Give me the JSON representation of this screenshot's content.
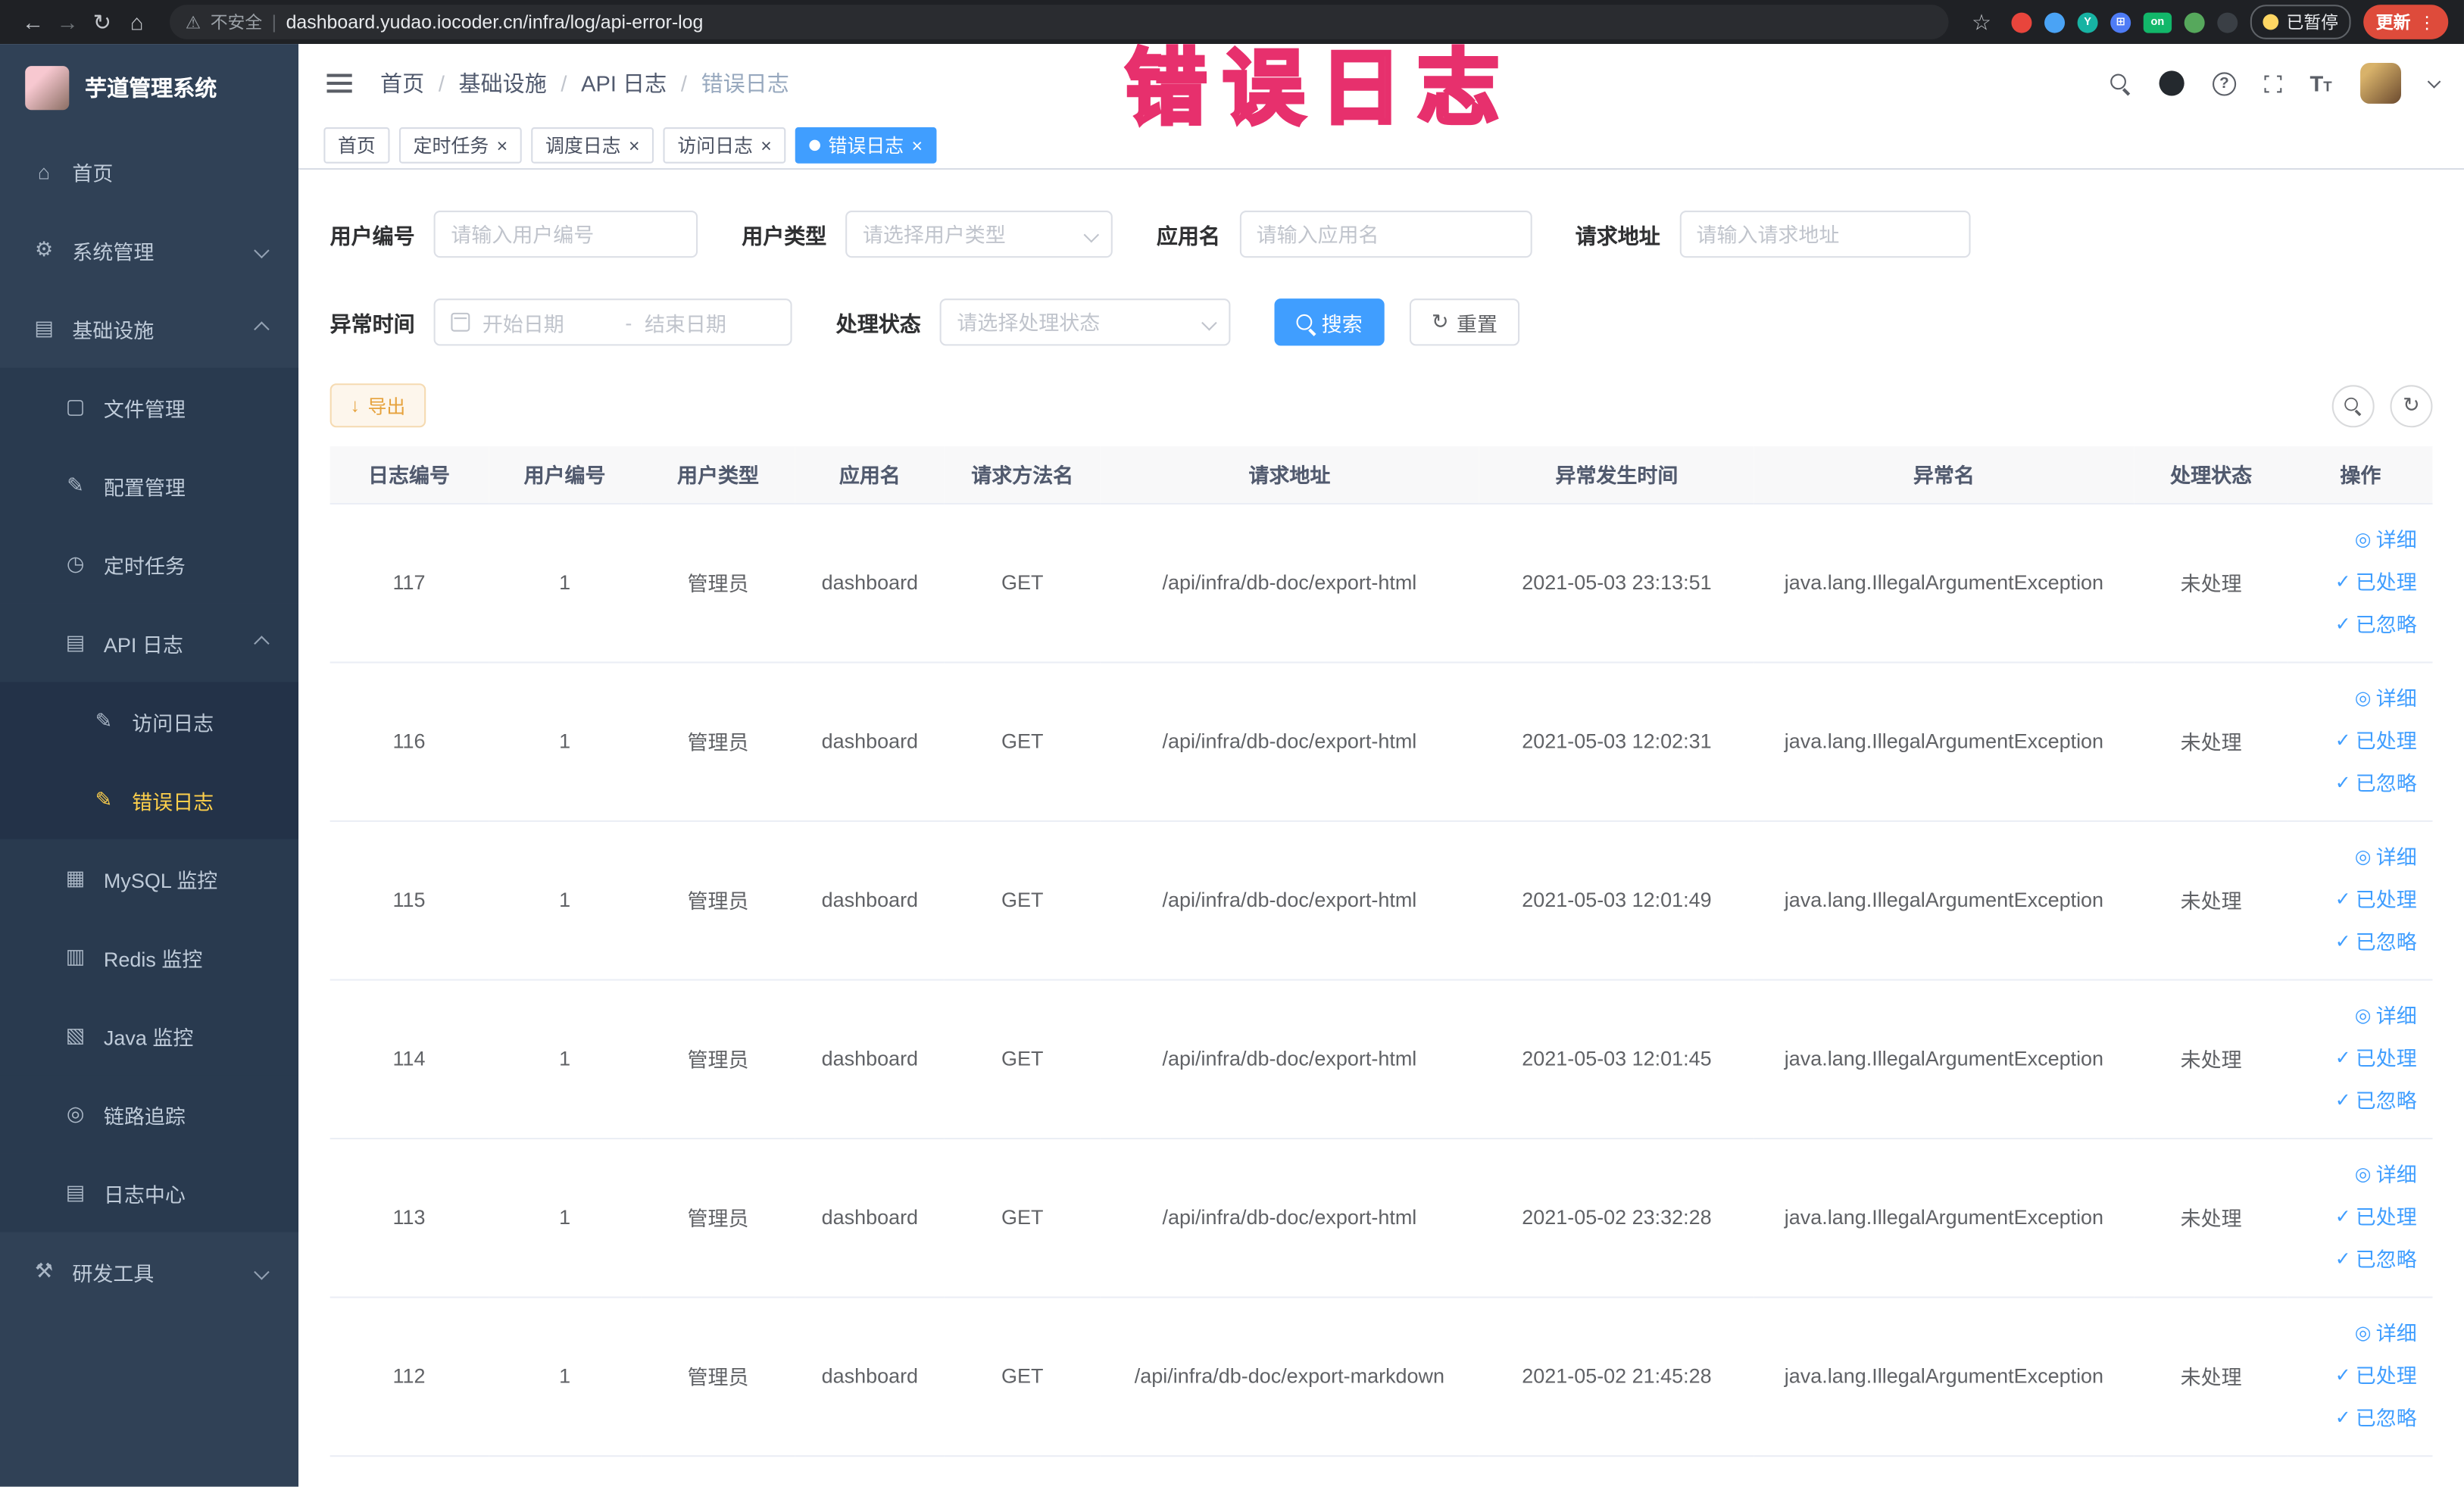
{
  "colors": {
    "accent": "#409eff",
    "sidebar_bg": "#304156",
    "sidebar_active_text": "#ffd04b",
    "warning": "#e6a23c",
    "update_button_red": "#de4b3b",
    "watermark_pink": "#e7306d",
    "link": "#409eff"
  },
  "watermark": "错误日志",
  "browser": {
    "security_label": "不安全",
    "url": "dashboard.yudao.iocoder.cn/infra/log/api-error-log",
    "paused_badge": "已暂停",
    "update_button": "更新",
    "nav_icons": [
      "back-arrow-icon",
      "forward-arrow-icon",
      "reload-icon",
      "home-icon"
    ],
    "extension_icons": [
      {
        "name": "extension-red-circle-icon",
        "color": "#e8453c",
        "glyph": "",
        "shape": "circle"
      },
      {
        "name": "extension-blue-drop-icon",
        "color": "#4aa3f5",
        "glyph": "",
        "shape": "circle"
      },
      {
        "name": "extension-teal-y-icon",
        "color": "#17b3a3",
        "glyph": "Y",
        "shape": "circle"
      },
      {
        "name": "extension-blue-grid-icon",
        "color": "#4e7cf6",
        "glyph": "⊞",
        "shape": "circle"
      },
      {
        "name": "extension-green-on-icon",
        "color": "#12b76a",
        "glyph": "on",
        "shape": "wide"
      },
      {
        "name": "extension-green-leaf-icon",
        "color": "#56a85c",
        "glyph": "",
        "shape": "circle"
      },
      {
        "name": "extension-dark-paw-icon",
        "color": "#3a3f45",
        "glyph": "",
        "shape": "circle"
      }
    ]
  },
  "sidebar": {
    "logo_title": "芋道管理系统",
    "items": [
      {
        "key": "home",
        "label": "首页",
        "icon": "home",
        "level": 0
      },
      {
        "key": "system",
        "label": "系统管理",
        "icon": "gear",
        "level": 0,
        "arrow": "down"
      },
      {
        "key": "infra",
        "label": "基础设施",
        "icon": "infra",
        "level": 0,
        "arrow": "up"
      },
      {
        "key": "file",
        "label": "文件管理",
        "icon": "file",
        "level": 1
      },
      {
        "key": "config",
        "label": "配置管理",
        "icon": "config",
        "level": 1
      },
      {
        "key": "job",
        "label": "定时任务",
        "icon": "job",
        "level": 1
      },
      {
        "key": "api-log",
        "label": "API 日志",
        "icon": "api-log",
        "level": 1,
        "arrow": "up"
      },
      {
        "key": "access-log",
        "label": "访问日志",
        "icon": "access-log",
        "level": 2
      },
      {
        "key": "error-log",
        "label": "错误日志",
        "icon": "error-log",
        "level": 2,
        "active": true
      },
      {
        "key": "mysql",
        "label": "MySQL 监控",
        "icon": "mysql",
        "level": 1
      },
      {
        "key": "redis",
        "label": "Redis 监控",
        "icon": "redis",
        "level": 1
      },
      {
        "key": "java",
        "label": "Java 监控",
        "icon": "java",
        "level": 1
      },
      {
        "key": "trace",
        "label": "链路追踪",
        "icon": "trace",
        "level": 1
      },
      {
        "key": "log-center",
        "label": "日志中心",
        "icon": "log-center",
        "level": 1
      },
      {
        "key": "devtools",
        "label": "研发工具",
        "icon": "devtools",
        "level": 0,
        "arrow": "down"
      }
    ]
  },
  "breadcrumb": [
    "首页",
    "基础设施",
    "API 日志",
    "错误日志"
  ],
  "tabs": [
    {
      "label": "首页",
      "closable": false,
      "active": false
    },
    {
      "label": "定时任务",
      "closable": true,
      "active": false
    },
    {
      "label": "调度日志",
      "closable": true,
      "active": false
    },
    {
      "label": "访问日志",
      "closable": true,
      "active": false
    },
    {
      "label": "错误日志",
      "closable": true,
      "active": true
    }
  ],
  "filters": {
    "user_id": {
      "label": "用户编号",
      "placeholder": "请输入用户编号"
    },
    "user_type": {
      "label": "用户类型",
      "placeholder": "请选择用户类型"
    },
    "app_name": {
      "label": "应用名",
      "placeholder": "请输入应用名"
    },
    "request_url": {
      "label": "请求地址",
      "placeholder": "请输入请求地址"
    },
    "exception_time": {
      "label": "异常时间",
      "start_placeholder": "开始日期",
      "separator": "-",
      "end_placeholder": "结束日期"
    },
    "process_status": {
      "label": "处理状态",
      "placeholder": "请选择处理状态"
    },
    "search_button": "搜索",
    "reset_button": "重置"
  },
  "toolbar": {
    "export_button": "导出"
  },
  "table": {
    "columns": [
      "日志编号",
      "用户编号",
      "用户类型",
      "应用名",
      "请求方法名",
      "请求地址",
      "异常发生时间",
      "异常名",
      "处理状态",
      "操作"
    ],
    "actions": [
      {
        "key": "detail",
        "label": "详细",
        "icon": "view"
      },
      {
        "key": "processed",
        "label": "已处理",
        "icon": "check"
      },
      {
        "key": "ignored",
        "label": "已忽略",
        "icon": "check"
      }
    ],
    "rows": [
      {
        "id": "117",
        "user_id": "1",
        "user_type": "管理员",
        "app": "dashboard",
        "method": "GET",
        "url": "/api/infra/db-doc/export-html",
        "time": "2021-05-03 23:13:51",
        "exception": "java.lang.IllegalArgumentException",
        "status": "未处理"
      },
      {
        "id": "116",
        "user_id": "1",
        "user_type": "管理员",
        "app": "dashboard",
        "method": "GET",
        "url": "/api/infra/db-doc/export-html",
        "time": "2021-05-03 12:02:31",
        "exception": "java.lang.IllegalArgumentException",
        "status": "未处理"
      },
      {
        "id": "115",
        "user_id": "1",
        "user_type": "管理员",
        "app": "dashboard",
        "method": "GET",
        "url": "/api/infra/db-doc/export-html",
        "time": "2021-05-03 12:01:49",
        "exception": "java.lang.IllegalArgumentException",
        "status": "未处理"
      },
      {
        "id": "114",
        "user_id": "1",
        "user_type": "管理员",
        "app": "dashboard",
        "method": "GET",
        "url": "/api/infra/db-doc/export-html",
        "time": "2021-05-03 12:01:45",
        "exception": "java.lang.IllegalArgumentException",
        "status": "未处理"
      },
      {
        "id": "113",
        "user_id": "1",
        "user_type": "管理员",
        "app": "dashboard",
        "method": "GET",
        "url": "/api/infra/db-doc/export-html",
        "time": "2021-05-02 23:32:28",
        "exception": "java.lang.IllegalArgumentException",
        "status": "未处理"
      },
      {
        "id": "112",
        "user_id": "1",
        "user_type": "管理员",
        "app": "dashboard",
        "method": "GET",
        "url": "/api/infra/db-doc/export-markdown",
        "time": "2021-05-02 21:45:28",
        "exception": "java.lang.IllegalArgumentException",
        "status": "未处理"
      }
    ]
  }
}
